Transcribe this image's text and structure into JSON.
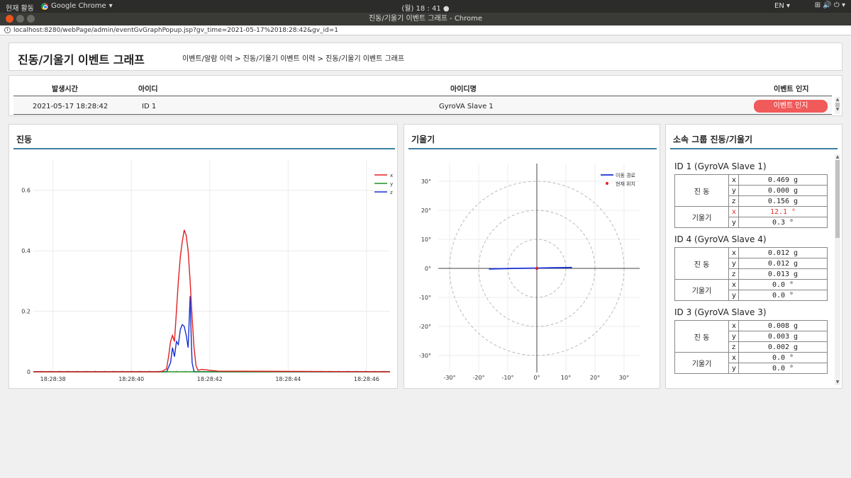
{
  "os": {
    "activities": "현재 활동",
    "app": "Google Chrome",
    "clock": "(월) 18 : 41 ●",
    "lang": "EN ▾",
    "tray": "⊞  🔊  ⏻ ▾"
  },
  "window": {
    "title": "진동/기울기 이벤트 그래프 - Chrome"
  },
  "address": {
    "url": "localhost:8280/webPage/admin/eventGvGraphPopup.jsp?gv_time=2021-05-17%2018:28:42&gv_id=1"
  },
  "header": {
    "title": "진동/기울기 이벤트 그래프",
    "breadcrumb": "이벤트/알람 이력 > 진동/기울기 이벤트 이력 > 진동/기울기 이벤트 그래프"
  },
  "event_table": {
    "columns": [
      "발생시간",
      "아이디",
      "아이디명",
      "이벤트 인지"
    ],
    "rows": [
      {
        "time": "2021-05-17 18:28:42",
        "id": "ID 1",
        "name": "GyroVA Slave 1",
        "ack": "이벤트 인지"
      }
    ]
  },
  "vibration": {
    "title": "진동"
  },
  "tilt": {
    "title": "기울기"
  },
  "group": {
    "title": "소속 그룹 진동/기울기",
    "vib_label": "진 동",
    "tilt_label": "기울기",
    "items": [
      {
        "name": "ID 1 (GyroVA Slave 1)",
        "vx": "0.469 g",
        "vy": "0.000 g",
        "vz": "0.156 g",
        "tx": "12.1 °",
        "ty": "0.3 °",
        "tx_alert": true
      },
      {
        "name": "ID 4 (GyroVA Slave 4)",
        "vx": "0.012 g",
        "vy": "0.012 g",
        "vz": "0.013 g",
        "tx": "0.0 °",
        "ty": "0.0 °",
        "tx_alert": false
      },
      {
        "name": "ID 3 (GyroVA Slave 3)",
        "vx": "0.008 g",
        "vy": "0.003 g",
        "vz": "0.002 g",
        "tx": "0.0 °",
        "ty": "0.0 °",
        "tx_alert": false
      }
    ]
  },
  "chart_data": [
    {
      "type": "line",
      "title": "",
      "xlabel": "",
      "ylabel": "",
      "x_ticks": [
        "18:28:38",
        "18:28:40",
        "18:28:42",
        "18:28:44",
        "18:28:46"
      ],
      "y_ticks": [
        0,
        0.2,
        0.4,
        0.6
      ],
      "xlim": [
        37.8,
        46.9
      ],
      "ylim": [
        0,
        0.7
      ],
      "grid": true,
      "legend": "top-right",
      "series": [
        {
          "name": "x",
          "color": "#e02020",
          "points": [
            [
              37.8,
              0
            ],
            [
              41.0,
              0
            ],
            [
              41.1,
              0.002
            ],
            [
              41.2,
              0.01
            ],
            [
              41.25,
              0.05
            ],
            [
              41.3,
              0.1
            ],
            [
              41.35,
              0.12
            ],
            [
              41.4,
              0.1
            ],
            [
              41.45,
              0.2
            ],
            [
              41.5,
              0.3
            ],
            [
              41.55,
              0.38
            ],
            [
              41.6,
              0.43
            ],
            [
              41.65,
              0.469
            ],
            [
              41.7,
              0.45
            ],
            [
              41.75,
              0.4
            ],
            [
              41.8,
              0.3
            ],
            [
              41.85,
              0.18
            ],
            [
              41.9,
              0.08
            ],
            [
              41.95,
              0.02
            ],
            [
              42.0,
              0.005
            ],
            [
              42.1,
              0.008
            ],
            [
              42.3,
              0.005
            ],
            [
              42.5,
              0.002
            ],
            [
              46.9,
              0
            ]
          ]
        },
        {
          "name": "y",
          "color": "#209020",
          "points": [
            [
              37.8,
              0
            ],
            [
              46.9,
              0
            ]
          ]
        },
        {
          "name": "z",
          "color": "#1830d0",
          "points": [
            [
              37.8,
              0
            ],
            [
              41.2,
              0
            ],
            [
              41.3,
              0.03
            ],
            [
              41.35,
              0.08
            ],
            [
              41.4,
              0.05
            ],
            [
              41.45,
              0.1
            ],
            [
              41.5,
              0.09
            ],
            [
              41.55,
              0.14
            ],
            [
              41.6,
              0.156
            ],
            [
              41.65,
              0.15
            ],
            [
              41.7,
              0.12
            ],
            [
              41.75,
              0.08
            ],
            [
              41.8,
              0.25
            ],
            [
              41.83,
              0.1
            ],
            [
              41.85,
              0.03
            ],
            [
              41.9,
              0
            ],
            [
              46.9,
              0
            ]
          ]
        }
      ]
    },
    {
      "type": "scatter",
      "title": "",
      "x_ticks": [
        "-30°",
        "-20°",
        "-10°",
        "0°",
        "10°",
        "20°",
        "30°"
      ],
      "y_ticks": [
        "30°",
        "20°",
        "10°",
        "0°",
        "-10°",
        "-20°",
        "-30°"
      ],
      "xlim": [
        -33,
        35
      ],
      "ylim": [
        -35,
        33
      ],
      "circles": [
        10,
        20,
        30
      ],
      "legend": "top-right",
      "series": [
        {
          "name": "이동 경로",
          "color": "#1830d0",
          "points": [
            [
              -16.5,
              -0.2
            ],
            [
              -8,
              0
            ],
            [
              0,
              0.1
            ],
            [
              5,
              0.2
            ],
            [
              12.1,
              0.3
            ]
          ]
        },
        {
          "name": "현재 위치",
          "color": "#e02020",
          "points": [
            [
              0,
              0
            ]
          ]
        }
      ]
    }
  ]
}
